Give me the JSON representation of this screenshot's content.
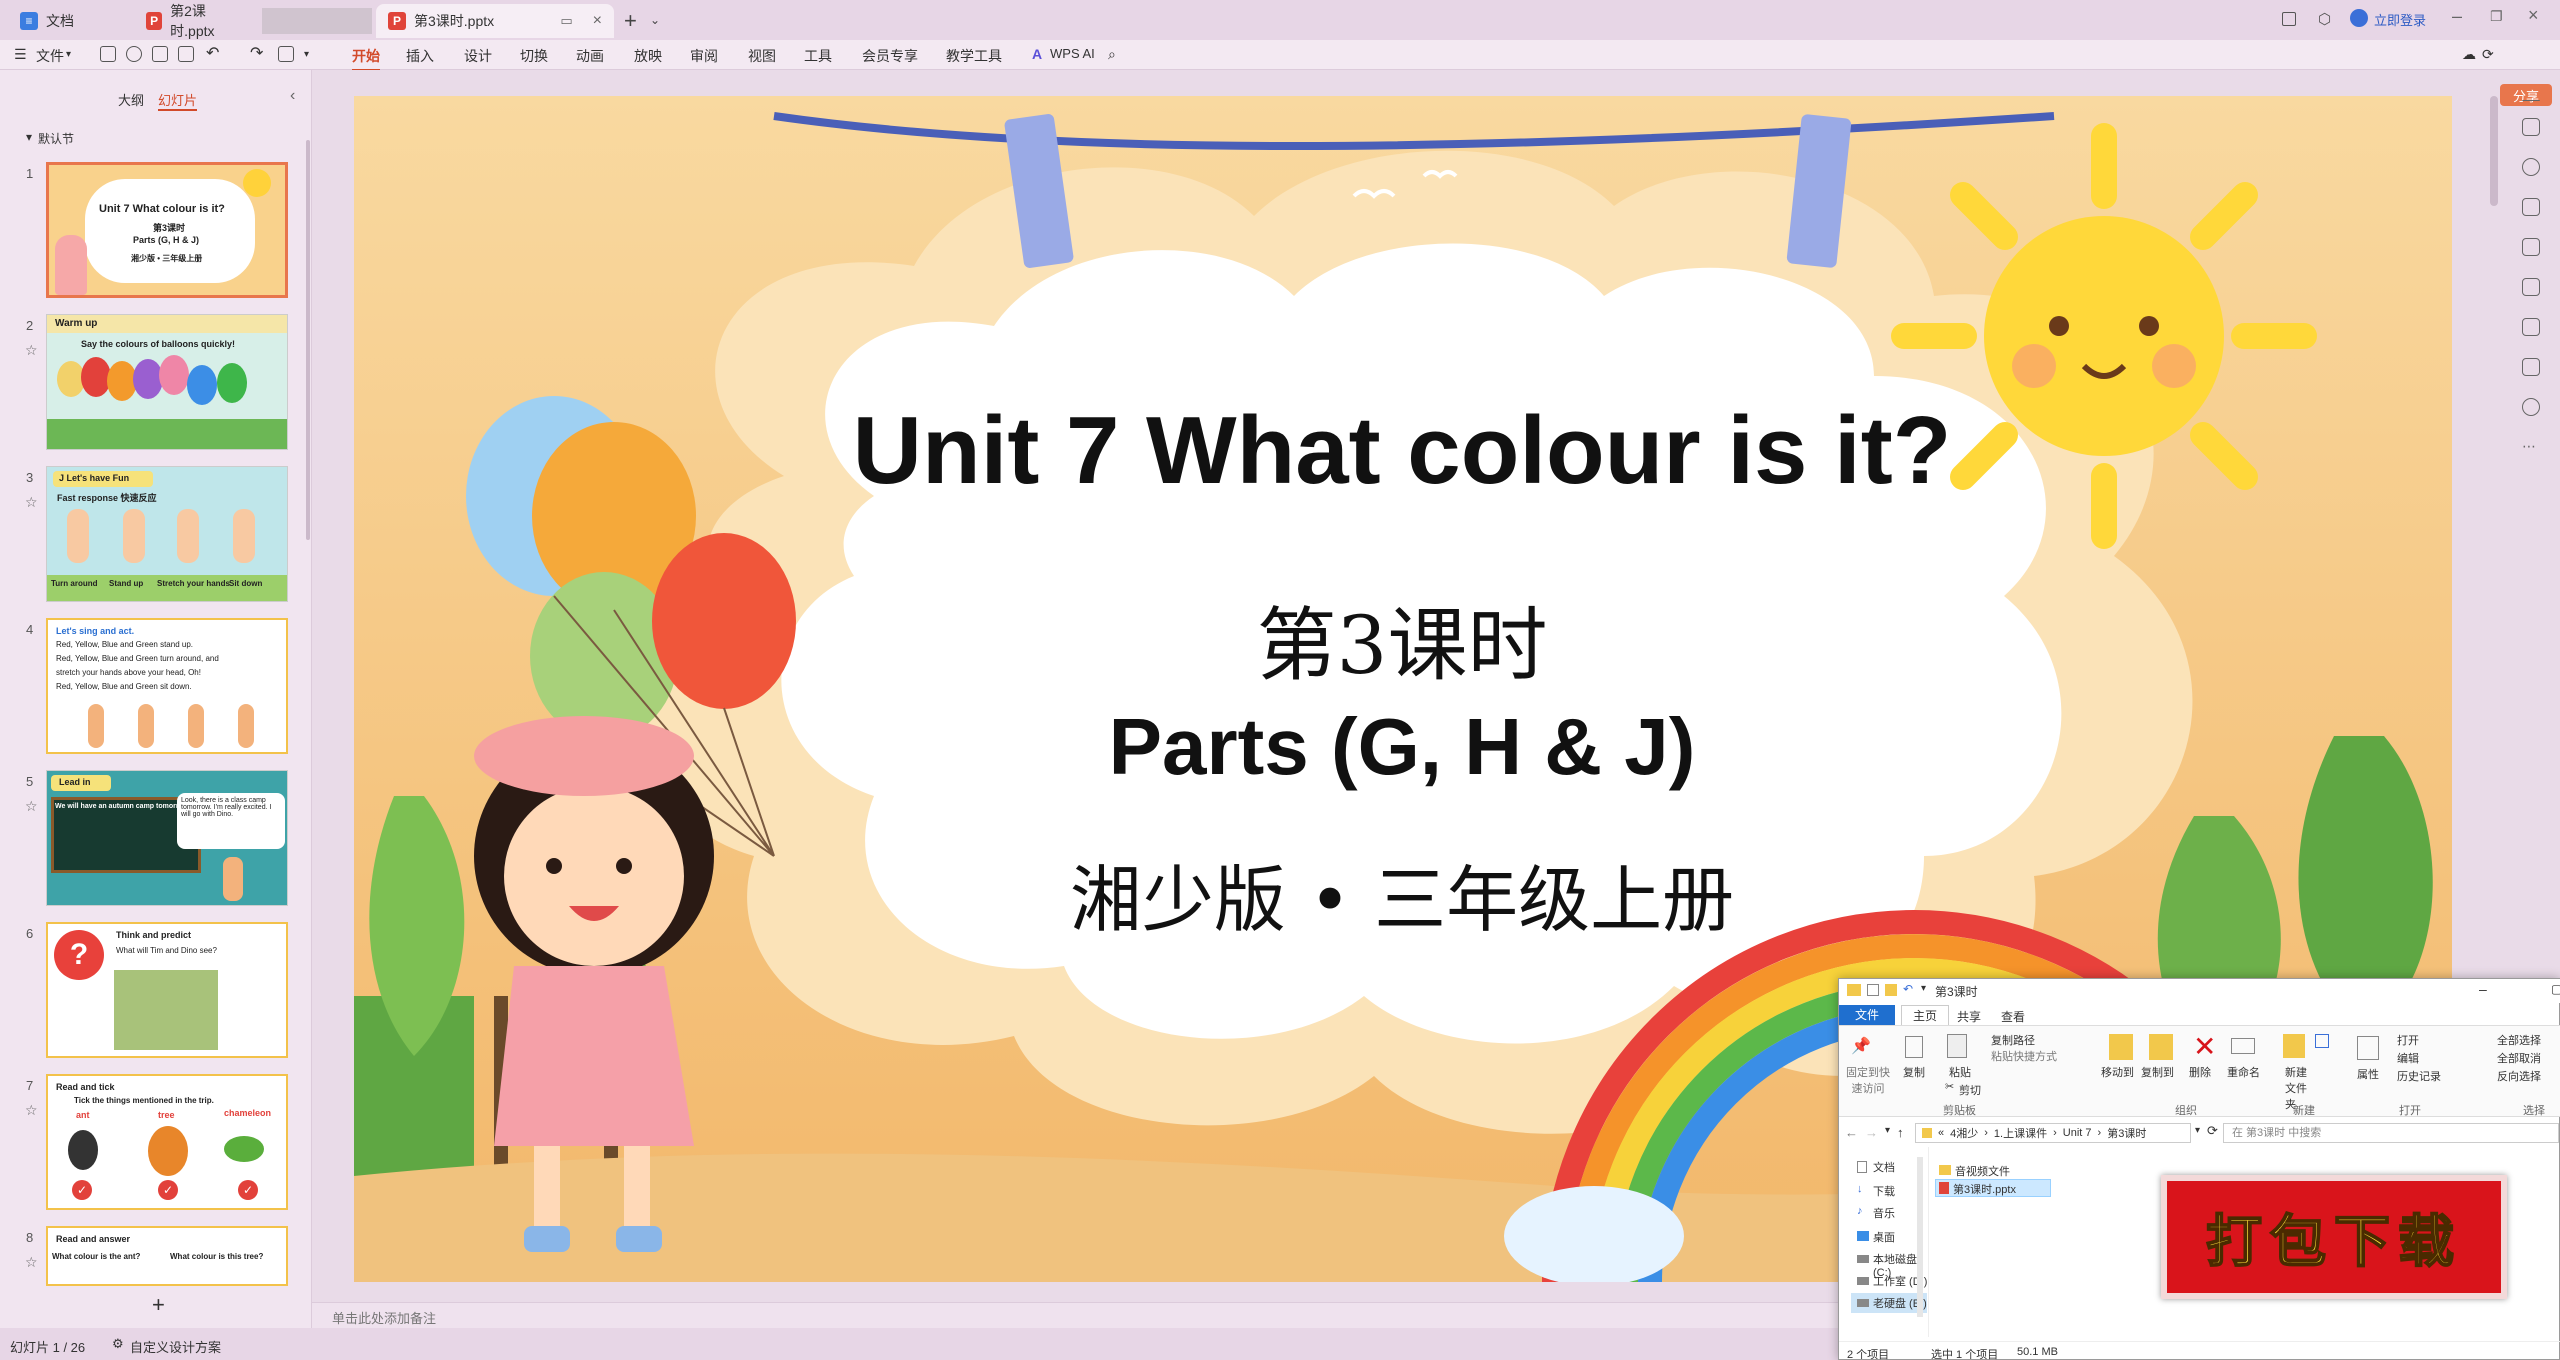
{
  "tabs": [
    {
      "label": "文档",
      "type": "doc"
    },
    {
      "label": "第2课时.pptx",
      "type": "ppt"
    },
    {
      "label": "第3课时.pptx",
      "type": "ppt",
      "active": true
    }
  ],
  "titlebar": {
    "login": "立即登录"
  },
  "menu": {
    "file": "文件",
    "items": [
      "开始",
      "插入",
      "设计",
      "切换",
      "动画",
      "放映",
      "审阅",
      "视图",
      "工具",
      "会员专享",
      "教学工具"
    ],
    "wps_ai": "WPS AI",
    "share": "分享"
  },
  "panel": {
    "tab_outline": "大纲",
    "tab_slides": "幻灯片",
    "section": "默认节",
    "add": "+"
  },
  "thumbs": [
    {
      "num": "1",
      "lines": [
        "Unit 7  What colour is it?",
        "第3课时",
        "Parts (G, H & J)",
        "湘少版 • 三年级上册"
      ]
    },
    {
      "num": "2",
      "lines": [
        "Warm up",
        "Say the colours of balloons quickly!"
      ]
    },
    {
      "num": "3",
      "lines": [
        "J  Let's have Fun",
        "Fast response 快速反应",
        "Turn around",
        "Stand up",
        "Stretch your hands",
        "Sit down"
      ]
    },
    {
      "num": "4",
      "lines": [
        "Let's sing and act.",
        "Red, Yellow, Blue and Green stand up.",
        "Red, Yellow, Blue and Green turn around, and",
        "stretch your hands above your head, Oh!",
        "Red, Yellow, Blue and Green sit down."
      ]
    },
    {
      "num": "5",
      "lines": [
        "Lead in",
        "Look, there is a class camp tomorrow. I'm really excited. I will go with Dino.",
        "We will have an autumn camp tomorrow."
      ]
    },
    {
      "num": "6",
      "lines": [
        "Think and predict",
        "What will Tim and Dino see?"
      ]
    },
    {
      "num": "7",
      "lines": [
        "Read and tick",
        "Tick the things mentioned in the trip.",
        "ant",
        "tree",
        "chameleon"
      ]
    },
    {
      "num": "8",
      "lines": [
        "Read and answer",
        "What colour is the ant?",
        "What colour is this tree?"
      ]
    }
  ],
  "slide": {
    "title": "Unit 7  What colour is it?",
    "lesson": "第3课时",
    "parts": "Parts (G, H & J)",
    "edition": "湘少版 • 三年级上册"
  },
  "notes_placeholder": "单击此处添加备注",
  "status": {
    "slide_count": "幻灯片 1 / 26",
    "design": "自定义设计方案"
  },
  "explorer": {
    "title": "第3课时",
    "ribbon_tabs": [
      "文件",
      "主页",
      "共享",
      "查看"
    ],
    "groups": [
      "剪贴板",
      "组织",
      "新建",
      "打开",
      "选择"
    ],
    "buttons": [
      "固定到快速访问",
      "复制",
      "粘贴",
      "剪切",
      "复制路径",
      "粘贴快捷方式",
      "移动到",
      "复制到",
      "删除",
      "重命名",
      "新建文件夹",
      "属性",
      "打开",
      "编辑",
      "历史记录",
      "全部选择",
      "全部取消",
      "反向选择"
    ],
    "path": [
      "4湘少",
      "1.上课课件",
      "Unit 7",
      "第3课时"
    ],
    "search_placeholder": "在 第3课时 中搜索",
    "sidebar": [
      "文档",
      "下载",
      "音乐",
      "桌面",
      "本地磁盘 (C:)",
      "工作室 (D:)",
      "老硬盘 (E:)"
    ],
    "files": [
      "音视频文件",
      "第3课时.pptx"
    ],
    "status_items": "2 个项目",
    "status_selected": "选中 1 个项目",
    "status_size": "50.1 MB"
  },
  "banner": "打包下载",
  "colors": {
    "accent": "#d24a2a",
    "banner_red": "#d9141b",
    "banner_text": "#ffe23a"
  }
}
